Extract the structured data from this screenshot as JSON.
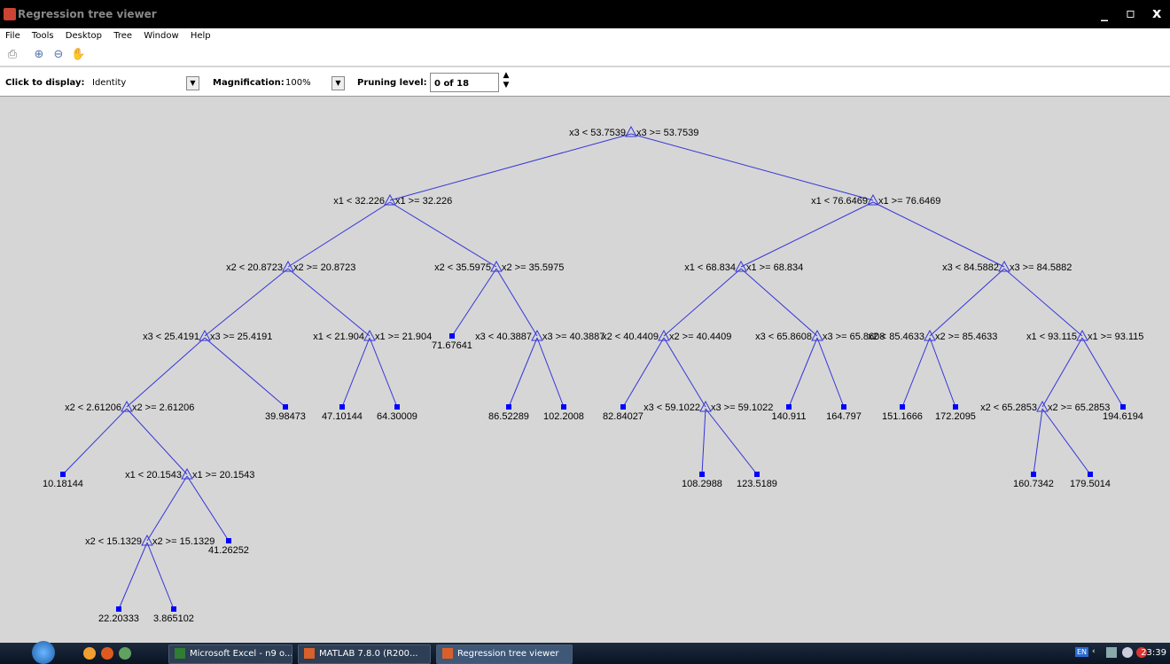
{
  "window": {
    "title": "Regression tree viewer",
    "controls": [
      "_",
      "▫",
      "x"
    ]
  },
  "menu": [
    "File",
    "Tools",
    "Desktop",
    "Tree",
    "Window",
    "Help"
  ],
  "toolbar": [
    "print-icon",
    "zoom-in-icon",
    "zoom-out-icon",
    "pan-hand-icon"
  ],
  "controls": {
    "display_label": "Click to display:",
    "display_value": "Identity",
    "magnification_label": "Magnification:",
    "magnification_value": "100%",
    "pruning_label": "Pruning level:",
    "pruning_value": "0 of 18"
  },
  "tree": {
    "nodes": [
      {
        "id": "n1",
        "type": "split",
        "left": "x3 < 53.7539",
        "right": "x3 >= 53.7539"
      },
      {
        "id": "n2",
        "type": "split",
        "left": "x1 < 32.226",
        "right": "x1 >= 32.226",
        "parent": "n1"
      },
      {
        "id": "n3",
        "type": "split",
        "left": "x1 < 76.6469",
        "right": "x1 >= 76.6469",
        "parent": "n1"
      },
      {
        "id": "n4",
        "type": "split",
        "left": "x2 < 20.8723",
        "right": "x2 >= 20.8723",
        "parent": "n2"
      },
      {
        "id": "n5",
        "type": "split",
        "left": "x2 < 35.5975",
        "right": "x2 >= 35.5975",
        "parent": "n2"
      },
      {
        "id": "n6",
        "type": "split",
        "left": "x1 < 68.834",
        "right": "x1 >= 68.834",
        "parent": "n3"
      },
      {
        "id": "n7",
        "type": "split",
        "left": "x3 < 84.5882",
        "right": "x3 >= 84.5882",
        "parent": "n3"
      },
      {
        "id": "n8",
        "type": "split",
        "left": "x3 < 25.4191",
        "right": "x3 >= 25.4191",
        "parent": "n4"
      },
      {
        "id": "n9",
        "type": "split",
        "left": "x1 < 21.904",
        "right": "x1 >= 21.904",
        "parent": "n4"
      },
      {
        "id": "n10",
        "type": "leaf",
        "value": "71.67641",
        "parent": "n5"
      },
      {
        "id": "n11",
        "type": "split",
        "left": "x3 < 40.3887",
        "right": "x3 >= 40.3887",
        "parent": "n5"
      },
      {
        "id": "n12",
        "type": "split",
        "left": "x2 < 40.4409",
        "right": "x2 >= 40.4409",
        "parent": "n6"
      },
      {
        "id": "n13",
        "type": "split",
        "left": "x3 < 65.8608",
        "right": "x3 >= 65.8608",
        "parent": "n6"
      },
      {
        "id": "n14",
        "type": "split",
        "left": "x2 < 85.4633",
        "right": "x2 >= 85.4633",
        "parent": "n7"
      },
      {
        "id": "n15",
        "type": "split",
        "left": "x1 < 93.115",
        "right": "x1 >= 93.115",
        "parent": "n7"
      },
      {
        "id": "n16",
        "type": "split",
        "left": "x2 < 2.61206",
        "right": "x2 >= 2.61206",
        "parent": "n8"
      },
      {
        "id": "n17",
        "type": "leaf",
        "value": "39.98473",
        "parent": "n8"
      },
      {
        "id": "n18",
        "type": "leaf",
        "value": "47.10144",
        "parent": "n9"
      },
      {
        "id": "n19",
        "type": "leaf",
        "value": "64.30009",
        "parent": "n9"
      },
      {
        "id": "n20",
        "type": "leaf",
        "value": "86.52289",
        "parent": "n11"
      },
      {
        "id": "n21",
        "type": "leaf",
        "value": "102.2008",
        "parent": "n11"
      },
      {
        "id": "n22",
        "type": "leaf",
        "value": "82.84027",
        "parent": "n12"
      },
      {
        "id": "n23",
        "type": "split",
        "left": "x3 < 59.1022",
        "right": "x3 >= 59.1022",
        "parent": "n12"
      },
      {
        "id": "n24",
        "type": "leaf",
        "value": "140.911",
        "parent": "n13"
      },
      {
        "id": "n25",
        "type": "leaf",
        "value": "164.797",
        "parent": "n13"
      },
      {
        "id": "n26",
        "type": "leaf",
        "value": "151.1666",
        "parent": "n14"
      },
      {
        "id": "n27",
        "type": "leaf",
        "value": "172.2095",
        "parent": "n14"
      },
      {
        "id": "n28",
        "type": "split",
        "left": "x2 < 65.2853",
        "right": "x2 >= 65.2853",
        "parent": "n15"
      },
      {
        "id": "n29",
        "type": "leaf",
        "value": "194.6194",
        "parent": "n15"
      },
      {
        "id": "n30",
        "type": "leaf",
        "value": "10.18144",
        "parent": "n16"
      },
      {
        "id": "n31",
        "type": "split",
        "left": "x1 < 20.1543",
        "right": "x1 >= 20.1543",
        "parent": "n16"
      },
      {
        "id": "n32",
        "type": "leaf",
        "value": "108.2988",
        "parent": "n23"
      },
      {
        "id": "n33",
        "type": "leaf",
        "value": "123.5189",
        "parent": "n23"
      },
      {
        "id": "n34",
        "type": "leaf",
        "value": "160.7342",
        "parent": "n28"
      },
      {
        "id": "n35",
        "type": "leaf",
        "value": "179.5014",
        "parent": "n28"
      },
      {
        "id": "n36",
        "type": "split",
        "left": "x2 < 15.1329",
        "right": "x2 >= 15.1329",
        "parent": "n31"
      },
      {
        "id": "n37",
        "type": "leaf",
        "value": "41.26252",
        "parent": "n31"
      },
      {
        "id": "n38",
        "type": "leaf",
        "value": "22.20333",
        "parent": "n36"
      },
      {
        "id": "n39",
        "type": "leaf",
        "value": "3.865102",
        "parent": "n36"
      }
    ]
  },
  "taskbar": {
    "tasks": [
      "Microsoft Excel - n9 o...",
      "MATLAB 7.8.0 (R200...",
      "Regression tree viewer"
    ],
    "language": "EN",
    "clock": "23:39"
  },
  "colors": {
    "tree_line": "#3535d8",
    "leaf_dot": "#0000ff",
    "canvas_bg": "#d6d6d6",
    "titlebar": "#000000",
    "taskbar": "#1b2a3d"
  }
}
